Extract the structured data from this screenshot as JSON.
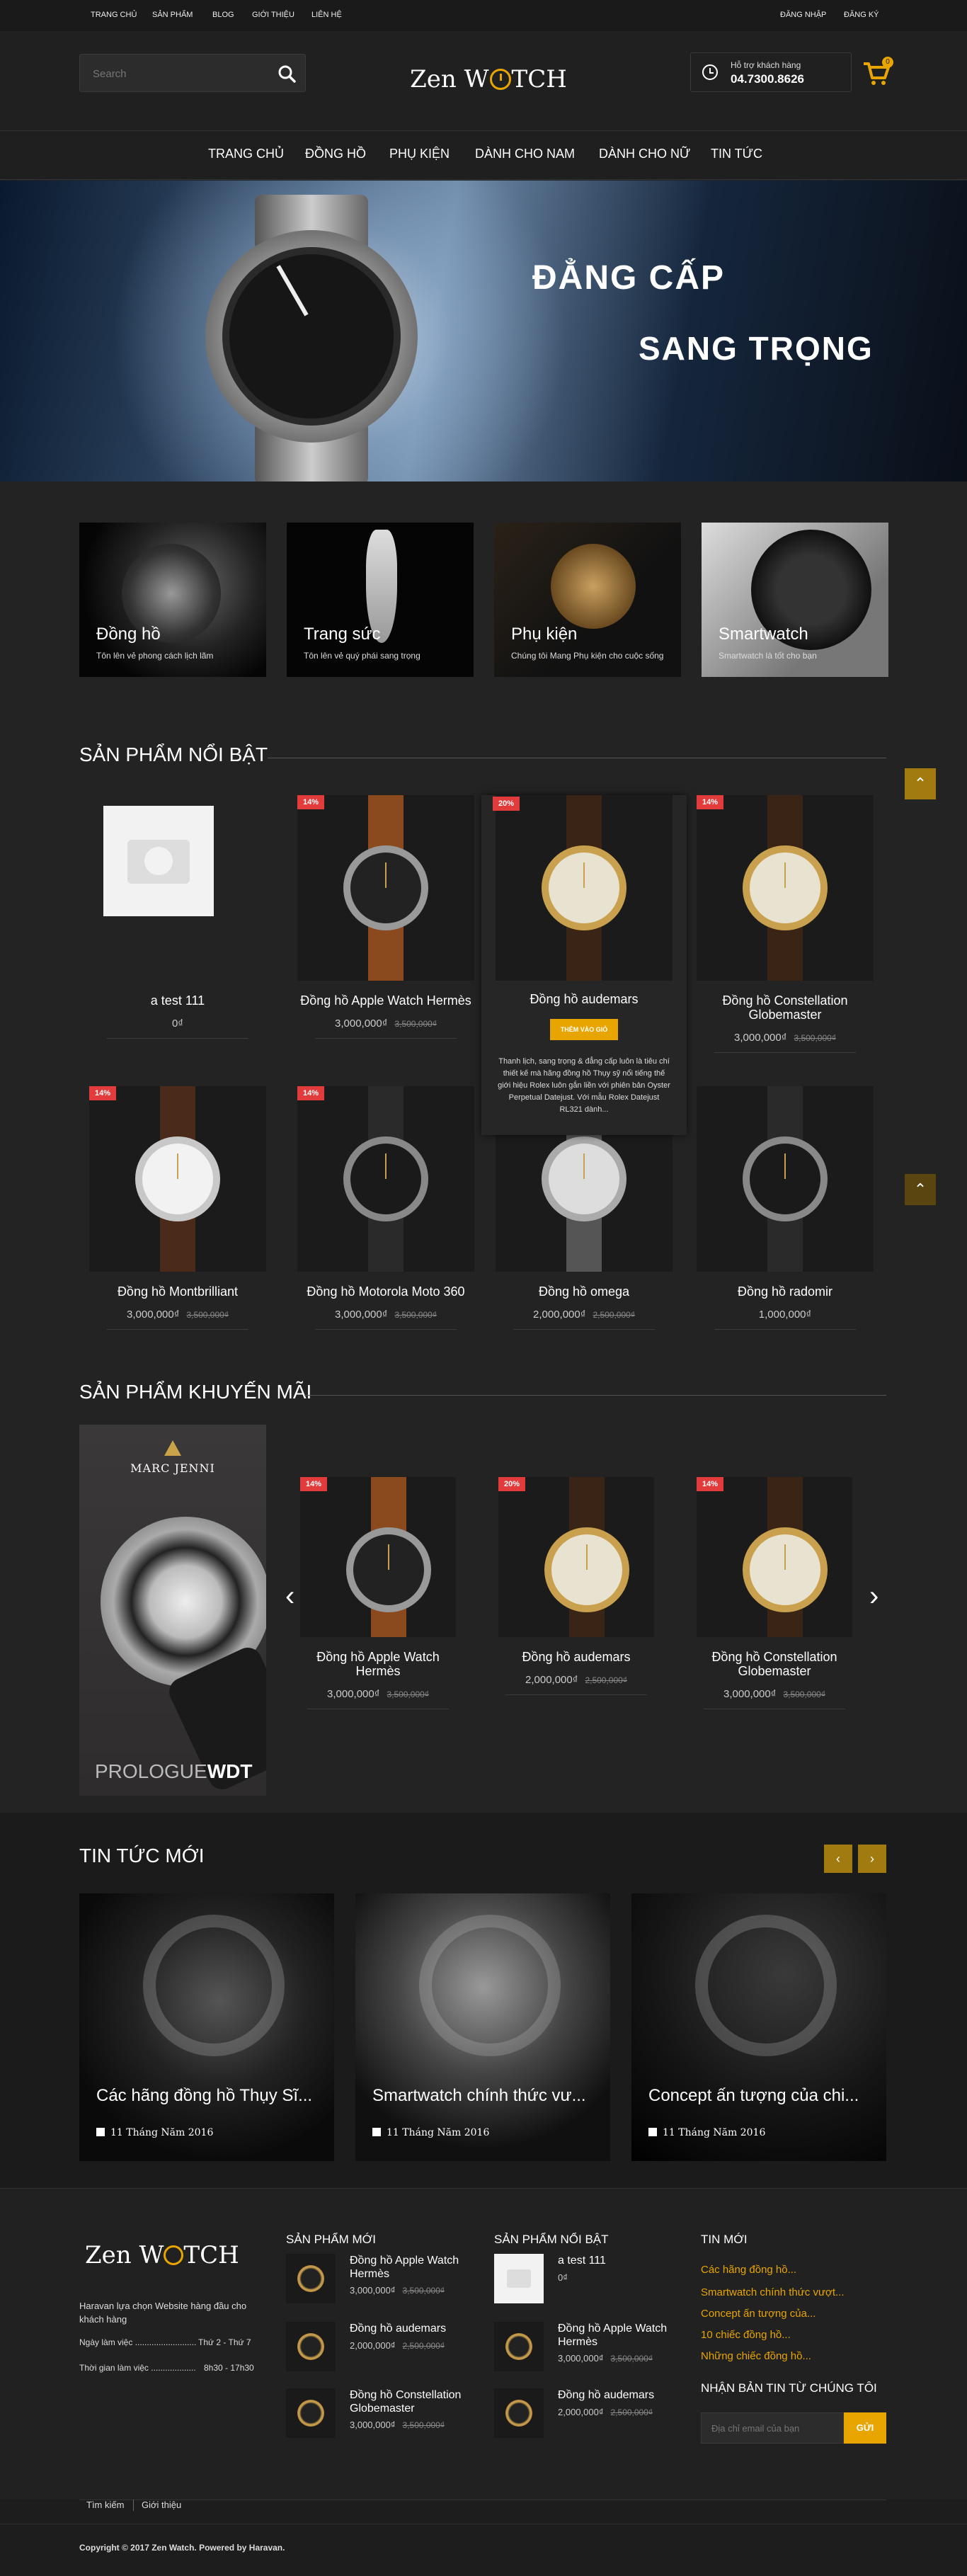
{
  "topbar": {
    "links": [
      "TRANG CHỦ",
      "SẢN PHẨM",
      "BLOG",
      "GIỚI THIỆU",
      "LIÊN HỆ"
    ],
    "login": "ĐĂNG NHẬP",
    "register": "ĐĂNG KÝ"
  },
  "header": {
    "search_placeholder": "Search",
    "logo_left": "Zen W",
    "logo_right": "TCH",
    "support_label": "Hỗ trợ khách hàng",
    "support_phone": "04.7300.8626",
    "cart_count": "0"
  },
  "nav": [
    "TRANG CHỦ",
    "ĐỒNG HỒ",
    "PHỤ KIỆN",
    "DÀNH CHO NAM",
    "DÀNH CHO NỮ",
    "TIN TỨC"
  ],
  "hero": {
    "line1": "ĐẲNG CẤP",
    "line2": "SANG TRỌNG"
  },
  "categories": [
    {
      "title": "Đồng hồ",
      "sub": "Tôn lên vẻ phong cách lịch lãm"
    },
    {
      "title": "Trang sức",
      "sub": "Tôn lên vẻ quý phái sang trọng"
    },
    {
      "title": "Phụ kiện",
      "sub": "Chúng tôi Mang Phụ kiện cho cuộc sống"
    },
    {
      "title": "Smartwatch",
      "sub": "Smartwatch là tốt cho bạn"
    }
  ],
  "featured": {
    "title": "SẢN PHẨM NỔI BẬT",
    "add_to_cart": "THÊM VÀO GIỎ",
    "hover_desc": "Thanh lịch, sang trọng & đẳng cấp luôn là tiêu chí thiết kế mà hãng đồng hồ Thụy sỹ nổi tiếng thế giới hiệu Rolex luôn gắn liền với phiên bản Oyster Perpetual Datejust. Với mẫu Rolex Datejust RL321 dành...",
    "items": [
      {
        "name": "a test 111",
        "price": "0₫",
        "old": "",
        "badge": ""
      },
      {
        "name": "Đồng hồ Apple Watch Hermès",
        "price": "3,000,000₫",
        "old": "3,500,000₫",
        "badge": "14%"
      },
      {
        "name": "Đồng hồ audemars",
        "price": "2,000,000₫",
        "old": "2,500,000₫",
        "badge": "20%"
      },
      {
        "name": "Đồng hồ Constellation Globemaster",
        "price": "3,000,000₫",
        "old": "3,500,000₫",
        "badge": "14%"
      },
      {
        "name": "Đồng hồ Montbrilliant",
        "price": "3,000,000₫",
        "old": "3,500,000₫",
        "badge": "14%"
      },
      {
        "name": "Đồng hồ Motorola Moto 360",
        "price": "3,000,000₫",
        "old": "3,500,000₫",
        "badge": "14%"
      },
      {
        "name": "Đồng hồ omega",
        "price": "2,000,000₫",
        "old": "2,500,000₫",
        "badge": ""
      },
      {
        "name": "Đồng hồ radomir",
        "price": "1,000,000₫",
        "old": "",
        "badge": ""
      }
    ]
  },
  "promo": {
    "title": "SẢN PHẨM KHUYẾN MÃI",
    "banner_brand": "MARC JENNI",
    "banner_model_a": "PROLOGUE",
    "banner_model_b": "WDT",
    "items": [
      {
        "name": "Đồng hồ Apple Watch Hermès",
        "price": "3,000,000₫",
        "old": "3,500,000₫",
        "badge": "14%"
      },
      {
        "name": "Đồng hồ audemars",
        "price": "2,000,000₫",
        "old": "2,500,000₫",
        "badge": "20%"
      },
      {
        "name": "Đồng hồ Constellation Globemaster",
        "price": "3,000,000₫",
        "old": "3,500,000₫",
        "badge": "14%"
      }
    ]
  },
  "news": {
    "title": "TIN TỨC MỚI",
    "items": [
      {
        "title": "Các hãng đồng hồ Thụy Sĩ...",
        "date": "11 Tháng Năm 2016"
      },
      {
        "title": "Smartwatch chính thức vư...",
        "date": "11 Tháng Năm 2016"
      },
      {
        "title": "Concept ấn tượng của chi...",
        "date": "11 Tháng Năm 2016"
      }
    ]
  },
  "footer": {
    "about": "Haravan lựa chọn Website hàng đầu cho khách hàng",
    "hours1_label": "Ngày làm việc ..........................",
    "hours1_value": "Thứ 2 - Thứ 7",
    "hours2_label": "Thời gian làm việc ...................",
    "hours2_value": "8h30 - 17h30",
    "col_new": "SẢN PHẨM MỚI",
    "new_items": [
      {
        "name": "Đồng hồ Apple Watch Hermès",
        "price": "3,000,000₫",
        "old": "3,500,000₫"
      },
      {
        "name": "Đồng hồ audemars",
        "price": "2,000,000₫",
        "old": "2,500,000₫"
      },
      {
        "name": "Đồng hồ Constellation Globemaster",
        "price": "3,000,000₫",
        "old": "3,500,000₫"
      }
    ],
    "col_hot": "SẢN PHẨM NỔI BẬT",
    "hot_items": [
      {
        "name": "a test 111",
        "price": "0₫",
        "old": ""
      },
      {
        "name": "Đồng hồ Apple Watch Hermès",
        "price": "3,000,000₫",
        "old": "3,500,000₫"
      },
      {
        "name": "Đồng hồ audemars",
        "price": "2,000,000₫",
        "old": "2,500,000₫"
      }
    ],
    "col_news": "TIN MỚI",
    "news_links": [
      "Các hãng đồng hồ...",
      "Smartwatch chính thức vượt...",
      "Concept ấn tượng của...",
      "10 chiếc đồng hồ...",
      "Những chiếc đồng hồ..."
    ],
    "newsletter": "NHẬN BẢN TIN TỪ CHÚNG TÔI",
    "email_placeholder": "Địa chỉ email của bạn",
    "send": "GỬI",
    "bottom_links": [
      "Tìm kiếm",
      "Giới thiệu"
    ],
    "copyright": "Copyright © 2017 Zen Watch. Powered by Haravan."
  },
  "colors": {
    "accent": "#e8a500",
    "badge": "#e23b3b",
    "bg": "#232323"
  }
}
